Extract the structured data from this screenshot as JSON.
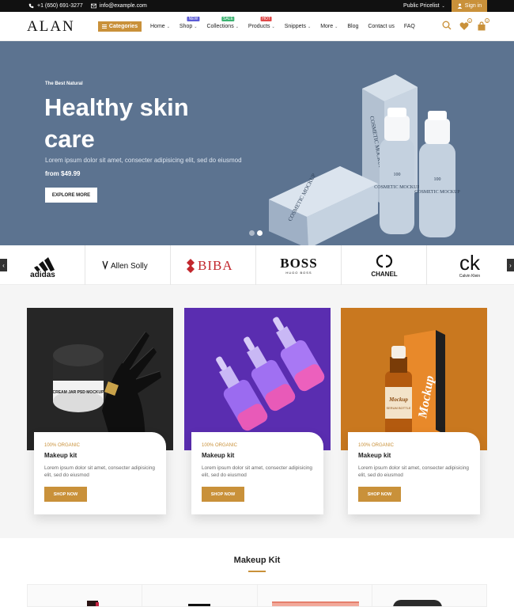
{
  "topbar": {
    "phone": "+1 (650) 691-3277",
    "email": "info@example.com",
    "pricelist": "Public Pricelist",
    "signin": "Sign in"
  },
  "header": {
    "logo": "ALAN",
    "categories": "Categories",
    "nav": [
      {
        "label": "Home",
        "caret": true,
        "badge": ""
      },
      {
        "label": "Shop",
        "caret": true,
        "badge": "NEW",
        "badge_color": "#5b5bd6"
      },
      {
        "label": "Collections",
        "caret": true,
        "badge": "SALE",
        "badge_color": "#3cb371"
      },
      {
        "label": "Products",
        "caret": true,
        "badge": "HOT",
        "badge_color": "#e04848"
      },
      {
        "label": "Snippets",
        "caret": true,
        "badge": ""
      },
      {
        "label": "More",
        "caret": true,
        "badge": ""
      },
      {
        "label": "Blog",
        "caret": false,
        "badge": ""
      },
      {
        "label": "Contact us",
        "caret": false,
        "badge": ""
      },
      {
        "label": "FAQ",
        "caret": false,
        "badge": ""
      }
    ],
    "wishlist_count": "0",
    "cart_count": "0"
  },
  "hero": {
    "eyebrow": "The Best Natural",
    "title": "Healthy skin care",
    "description": "Lorem ipsum dolor sit amet, consecter adipisicing elit, sed do eiusmod",
    "price": "from $49.99",
    "button": "EXPLORE MORE",
    "slide_count": 2,
    "active_slide": 2,
    "packaging_text": "COSMETIC MOCKUP",
    "packaging_number": "100"
  },
  "brands": [
    "adidas",
    "Allen Solly",
    "BIBA",
    "BOSS",
    "HUGO BOSS",
    "CHANEL",
    "ck",
    "Calvin Klein"
  ],
  "product_labels": {
    "jar": "CREAM JAR PSD MOCKUP",
    "bottle_label": "Mockup",
    "bottle_subtitle": "SERUM BOTTLE"
  },
  "features": [
    {
      "tag": "100% ORGANIC",
      "name": "Makeup kit",
      "text": "Lorem ipsum dolor sit amet, consecter adipisicing elit, sed do eiusmod",
      "button": "SHOP NOW"
    },
    {
      "tag": "100% ORGANIC",
      "name": "Makeup kit",
      "text": "Lorem ipsum dolor sit amet, consecter adipisicing elit, sed do eiusmod",
      "button": "SHOP NOW"
    },
    {
      "tag": "100% ORGANIC",
      "name": "Makeup kit",
      "text": "Lorem ipsum dolor sit amet, consecter adipisicing elit, sed do eiusmod",
      "button": "SHOP NOW"
    }
  ],
  "kit": {
    "title": "Makeup Kit"
  },
  "colors": {
    "accent": "#c9913a",
    "hero_bg": "#5c7390",
    "dark": "#111111"
  }
}
